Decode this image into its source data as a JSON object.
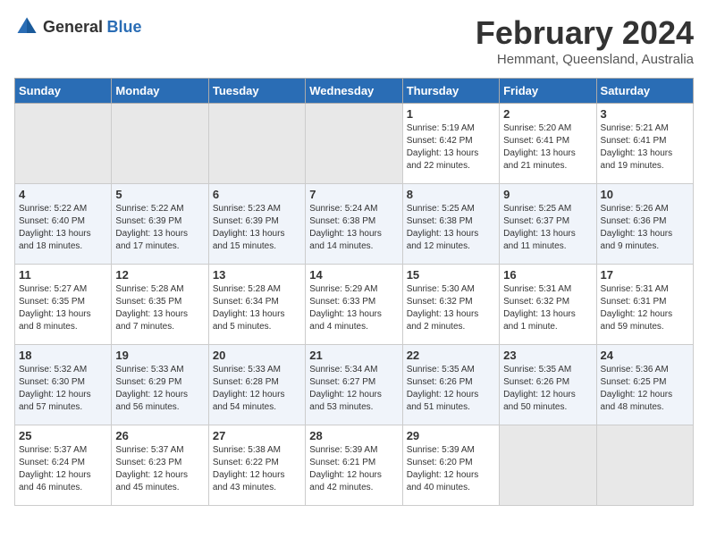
{
  "header": {
    "logo_general": "General",
    "logo_blue": "Blue",
    "month": "February 2024",
    "location": "Hemmant, Queensland, Australia"
  },
  "days_of_week": [
    "Sunday",
    "Monday",
    "Tuesday",
    "Wednesday",
    "Thursday",
    "Friday",
    "Saturday"
  ],
  "weeks": [
    {
      "days": [
        {
          "num": "",
          "empty": true
        },
        {
          "num": "",
          "empty": true
        },
        {
          "num": "",
          "empty": true
        },
        {
          "num": "",
          "empty": true
        },
        {
          "num": "1",
          "sunrise": "Sunrise: 5:19 AM",
          "sunset": "Sunset: 6:42 PM",
          "daylight": "Daylight: 13 hours and 22 minutes."
        },
        {
          "num": "2",
          "sunrise": "Sunrise: 5:20 AM",
          "sunset": "Sunset: 6:41 PM",
          "daylight": "Daylight: 13 hours and 21 minutes."
        },
        {
          "num": "3",
          "sunrise": "Sunrise: 5:21 AM",
          "sunset": "Sunset: 6:41 PM",
          "daylight": "Daylight: 13 hours and 19 minutes."
        }
      ]
    },
    {
      "days": [
        {
          "num": "4",
          "sunrise": "Sunrise: 5:22 AM",
          "sunset": "Sunset: 6:40 PM",
          "daylight": "Daylight: 13 hours and 18 minutes."
        },
        {
          "num": "5",
          "sunrise": "Sunrise: 5:22 AM",
          "sunset": "Sunset: 6:39 PM",
          "daylight": "Daylight: 13 hours and 17 minutes."
        },
        {
          "num": "6",
          "sunrise": "Sunrise: 5:23 AM",
          "sunset": "Sunset: 6:39 PM",
          "daylight": "Daylight: 13 hours and 15 minutes."
        },
        {
          "num": "7",
          "sunrise": "Sunrise: 5:24 AM",
          "sunset": "Sunset: 6:38 PM",
          "daylight": "Daylight: 13 hours and 14 minutes."
        },
        {
          "num": "8",
          "sunrise": "Sunrise: 5:25 AM",
          "sunset": "Sunset: 6:38 PM",
          "daylight": "Daylight: 13 hours and 12 minutes."
        },
        {
          "num": "9",
          "sunrise": "Sunrise: 5:25 AM",
          "sunset": "Sunset: 6:37 PM",
          "daylight": "Daylight: 13 hours and 11 minutes."
        },
        {
          "num": "10",
          "sunrise": "Sunrise: 5:26 AM",
          "sunset": "Sunset: 6:36 PM",
          "daylight": "Daylight: 13 hours and 9 minutes."
        }
      ]
    },
    {
      "days": [
        {
          "num": "11",
          "sunrise": "Sunrise: 5:27 AM",
          "sunset": "Sunset: 6:35 PM",
          "daylight": "Daylight: 13 hours and 8 minutes."
        },
        {
          "num": "12",
          "sunrise": "Sunrise: 5:28 AM",
          "sunset": "Sunset: 6:35 PM",
          "daylight": "Daylight: 13 hours and 7 minutes."
        },
        {
          "num": "13",
          "sunrise": "Sunrise: 5:28 AM",
          "sunset": "Sunset: 6:34 PM",
          "daylight": "Daylight: 13 hours and 5 minutes."
        },
        {
          "num": "14",
          "sunrise": "Sunrise: 5:29 AM",
          "sunset": "Sunset: 6:33 PM",
          "daylight": "Daylight: 13 hours and 4 minutes."
        },
        {
          "num": "15",
          "sunrise": "Sunrise: 5:30 AM",
          "sunset": "Sunset: 6:32 PM",
          "daylight": "Daylight: 13 hours and 2 minutes."
        },
        {
          "num": "16",
          "sunrise": "Sunrise: 5:31 AM",
          "sunset": "Sunset: 6:32 PM",
          "daylight": "Daylight: 13 hours and 1 minute."
        },
        {
          "num": "17",
          "sunrise": "Sunrise: 5:31 AM",
          "sunset": "Sunset: 6:31 PM",
          "daylight": "Daylight: 12 hours and 59 minutes."
        }
      ]
    },
    {
      "days": [
        {
          "num": "18",
          "sunrise": "Sunrise: 5:32 AM",
          "sunset": "Sunset: 6:30 PM",
          "daylight": "Daylight: 12 hours and 57 minutes."
        },
        {
          "num": "19",
          "sunrise": "Sunrise: 5:33 AM",
          "sunset": "Sunset: 6:29 PM",
          "daylight": "Daylight: 12 hours and 56 minutes."
        },
        {
          "num": "20",
          "sunrise": "Sunrise: 5:33 AM",
          "sunset": "Sunset: 6:28 PM",
          "daylight": "Daylight: 12 hours and 54 minutes."
        },
        {
          "num": "21",
          "sunrise": "Sunrise: 5:34 AM",
          "sunset": "Sunset: 6:27 PM",
          "daylight": "Daylight: 12 hours and 53 minutes."
        },
        {
          "num": "22",
          "sunrise": "Sunrise: 5:35 AM",
          "sunset": "Sunset: 6:26 PM",
          "daylight": "Daylight: 12 hours and 51 minutes."
        },
        {
          "num": "23",
          "sunrise": "Sunrise: 5:35 AM",
          "sunset": "Sunset: 6:26 PM",
          "daylight": "Daylight: 12 hours and 50 minutes."
        },
        {
          "num": "24",
          "sunrise": "Sunrise: 5:36 AM",
          "sunset": "Sunset: 6:25 PM",
          "daylight": "Daylight: 12 hours and 48 minutes."
        }
      ]
    },
    {
      "days": [
        {
          "num": "25",
          "sunrise": "Sunrise: 5:37 AM",
          "sunset": "Sunset: 6:24 PM",
          "daylight": "Daylight: 12 hours and 46 minutes."
        },
        {
          "num": "26",
          "sunrise": "Sunrise: 5:37 AM",
          "sunset": "Sunset: 6:23 PM",
          "daylight": "Daylight: 12 hours and 45 minutes."
        },
        {
          "num": "27",
          "sunrise": "Sunrise: 5:38 AM",
          "sunset": "Sunset: 6:22 PM",
          "daylight": "Daylight: 12 hours and 43 minutes."
        },
        {
          "num": "28",
          "sunrise": "Sunrise: 5:39 AM",
          "sunset": "Sunset: 6:21 PM",
          "daylight": "Daylight: 12 hours and 42 minutes."
        },
        {
          "num": "29",
          "sunrise": "Sunrise: 5:39 AM",
          "sunset": "Sunset: 6:20 PM",
          "daylight": "Daylight: 12 hours and 40 minutes."
        },
        {
          "num": "",
          "empty": true
        },
        {
          "num": "",
          "empty": true
        }
      ]
    }
  ]
}
